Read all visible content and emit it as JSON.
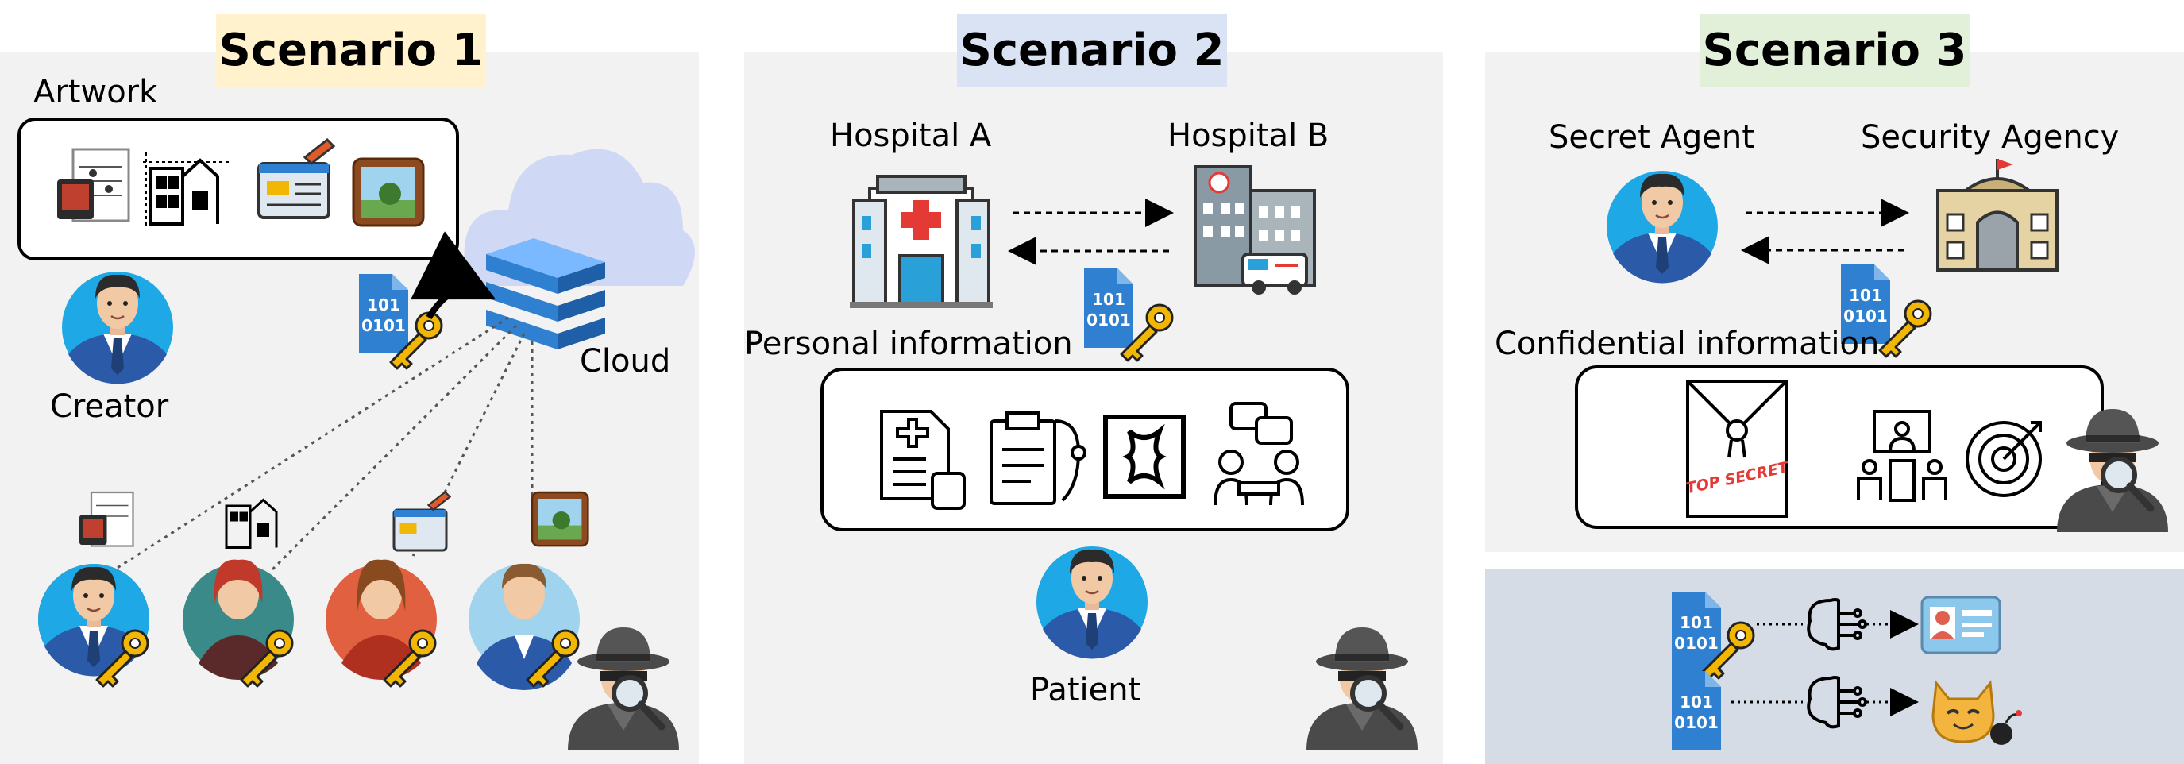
{
  "scenario1": {
    "title": "Scenario 1",
    "artwork_label": "Artwork",
    "creator_label": "Creator",
    "cloud_label": "Cloud"
  },
  "scenario2": {
    "title": "Scenario 2",
    "hospital_a_label": "Hospital A",
    "hospital_b_label": "Hospital B",
    "personal_info_label": "Personal information",
    "patient_label": "Patient"
  },
  "scenario3": {
    "title": "Scenario 3",
    "secret_agent_label": "Secret Agent",
    "security_agency_label": "Security Agency",
    "confidential_info_label": "Confidential information",
    "top_secret_text": "TOP SECRET"
  },
  "file_icon_text": [
    "101",
    "0101"
  ],
  "colors": {
    "title1_bg": "#fff2cc",
    "title2_bg": "#dae3f3",
    "title3_bg": "#e2f0d9",
    "panel_bg": "#f2f2f2",
    "bottom_bg": "#d6dce5",
    "file_blue": "#2f80d1",
    "key_gold": "#f2b705"
  }
}
